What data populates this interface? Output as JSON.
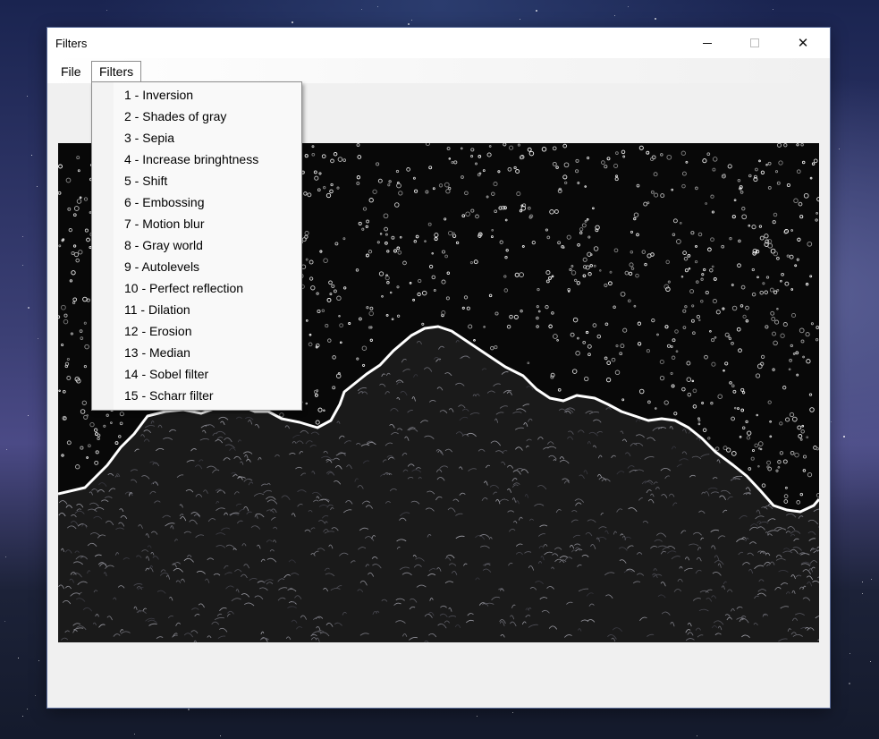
{
  "window": {
    "title": "Filters"
  },
  "menubar": {
    "file_label": "File",
    "filters_label": "Filters"
  },
  "filters_menu": {
    "items": [
      "1 - Inversion",
      "2 - Shades of gray",
      "3 - Sepia",
      "4 - Increase bringhtness",
      "5 - Shift",
      "6 - Embossing",
      "7 - Motion blur",
      "8 - Gray world",
      "9 - Autolevels",
      "10 - Perfect reflection",
      "11 - Dilation",
      "12 - Erosion",
      "13 - Median",
      "14 - Sobel filter",
      "15 - Scharr filter"
    ]
  },
  "colors": {
    "window_bg": "#f0f0f0",
    "image_bg": "#0a0a0a",
    "edge_line": "#ffffff",
    "menu_bg": "#f9f9f9"
  },
  "icons": {
    "minimize": "minimize-icon",
    "maximize": "maximize-icon",
    "close": "close-icon"
  }
}
